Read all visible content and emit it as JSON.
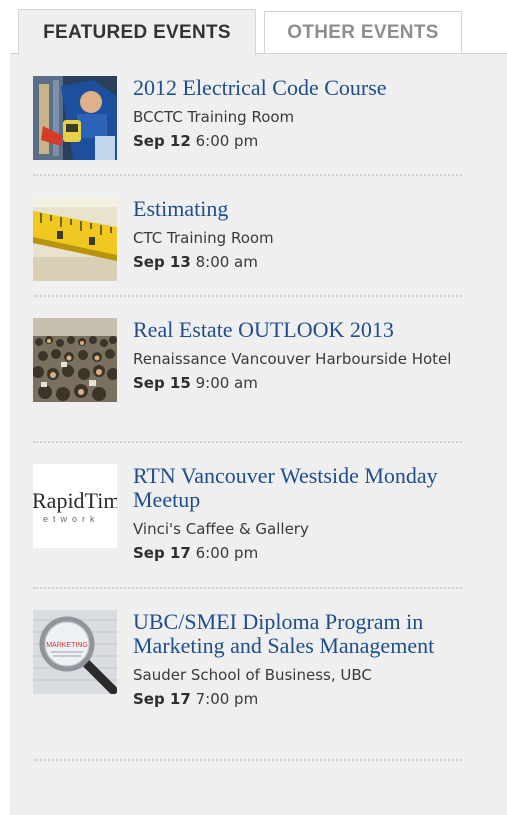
{
  "tabs": {
    "featured_label": "FEATURED EVENTS",
    "other_label": "OTHER EVENTS",
    "active": "featured"
  },
  "colors": {
    "title_link": "#1f4e8c",
    "panel_bg": "#efefef",
    "text": "#3a3a3a"
  },
  "events": [
    {
      "title": "2012 Electrical Code Course",
      "venue": "BCCTC Training Room",
      "date": "Sep 12",
      "time": "6:00 pm",
      "thumb": "electrician-photo"
    },
    {
      "title": "Estimating",
      "venue": "CTC Training Room",
      "date": "Sep 13",
      "time": "8:00 am",
      "thumb": "measuring-tape-photo"
    },
    {
      "title": "Real Estate OUTLOOK 2013",
      "venue": "Renaissance Vancouver Harbourside Hotel",
      "date": "Sep 15",
      "time": "9:00 am",
      "thumb": "crowd-photo"
    },
    {
      "title": "RTN Vancouver Westside Monday Meetup",
      "venue": "Vinci's Caffee & Gallery",
      "date": "Sep 17",
      "time": "6:00 pm",
      "thumb": "rapidtimes-logo",
      "logo_text": "RapidTime",
      "logo_sub": "etwork"
    },
    {
      "title": "UBC/SMEI Diploma Program in Marketing and Sales Management",
      "venue": "Sauder School of Business, UBC",
      "date": "Sep 17",
      "time": "7:00 pm",
      "thumb": "magnifier-marketing-photo",
      "lens_text": "MARKETING"
    }
  ]
}
